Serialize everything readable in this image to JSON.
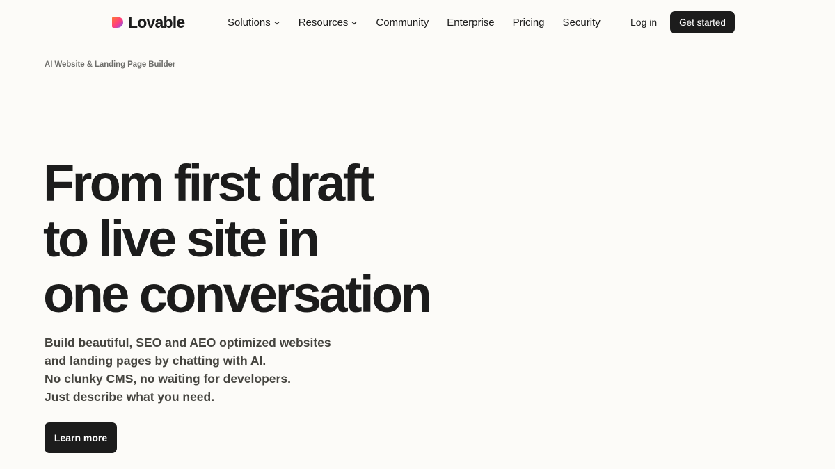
{
  "brand": {
    "name": "Lovable",
    "logo_icon": "heart-gradient-icon"
  },
  "nav": {
    "items": [
      {
        "label": "Solutions",
        "has_dropdown": true
      },
      {
        "label": "Resources",
        "has_dropdown": true
      },
      {
        "label": "Community",
        "has_dropdown": false
      },
      {
        "label": "Enterprise",
        "has_dropdown": false
      },
      {
        "label": "Pricing",
        "has_dropdown": false
      },
      {
        "label": "Security",
        "has_dropdown": false
      }
    ],
    "login_label": "Log in",
    "get_started_label": "Get started"
  },
  "hero": {
    "eyebrow": "AI Website & Landing Page Builder",
    "headline_lines": [
      "From first draft",
      "to live site in",
      "one conversation"
    ],
    "subtitle_lines": [
      "Build beautiful, SEO and AEO optimized websites",
      "and landing pages by chatting with AI.",
      "No clunky CMS, no waiting for developers.",
      "Just describe what you need."
    ],
    "cta_label": "Learn more"
  },
  "colors": {
    "background": "#fcfbf8",
    "text_primary": "#1c1c1c",
    "text_secondary": "#45443f",
    "button_bg": "#1c1c1c",
    "button_text": "#ffffff",
    "logo_gradient": [
      "#ff6a3d",
      "#ff3d7f",
      "#7b5cff"
    ]
  }
}
